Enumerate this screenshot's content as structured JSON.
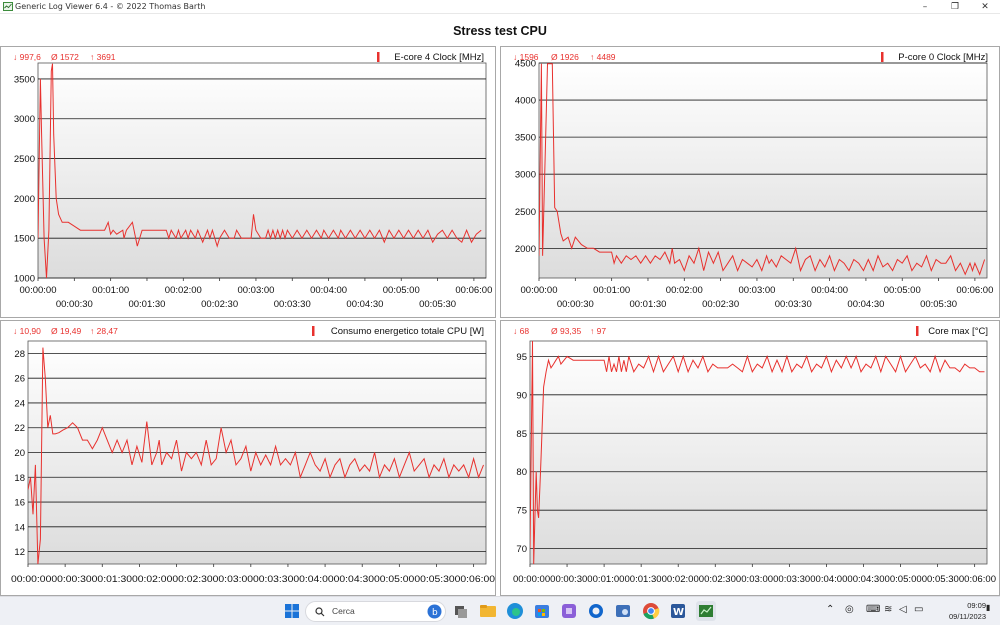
{
  "window": {
    "title": "Generic Log Viewer 6.4 - © 2022 Thomas Barth",
    "minimize": "–",
    "maximize": "❐",
    "close": "✕"
  },
  "headline": "Stress test CPU",
  "colors": {
    "line": "#e8312e",
    "grid": "#1a1a1a",
    "plotTop": "#ffffff",
    "plotBottom": "#dcdcdc"
  },
  "chart_data": [
    {
      "type": "line",
      "title": "E-core 4 Clock [MHz]",
      "stats": {
        "min": "997,6",
        "avg": "1572",
        "max": "3691"
      },
      "ylim": [
        1000,
        3700
      ],
      "yticks": [
        1000,
        1500,
        2000,
        2500,
        3000,
        3500
      ],
      "xlim": [
        0,
        370
      ],
      "xticks_top": [
        "00:00:00",
        "00:01:00",
        "00:02:00",
        "00:03:00",
        "00:04:00",
        "00:05:00",
        "00:06:00"
      ],
      "xticks_bottom": [
        "00:00:30",
        "00:01:30",
        "00:02:30",
        "00:03:30",
        "00:04:30",
        "00:05:30"
      ],
      "x": [
        0,
        2,
        3,
        5,
        7,
        9,
        11,
        12,
        13,
        15,
        17,
        20,
        25,
        30,
        35,
        40,
        48,
        55,
        58,
        60,
        62,
        65,
        70,
        71,
        73,
        78,
        82,
        86,
        90,
        95,
        100,
        103,
        106,
        108,
        110,
        114,
        116,
        118,
        122,
        124,
        126,
        130,
        132,
        136,
        140,
        142,
        144,
        148,
        150,
        154,
        158,
        162,
        164,
        168,
        172,
        176,
        178,
        180,
        184,
        188,
        190,
        192,
        194,
        196,
        198,
        200,
        202,
        204,
        206,
        210,
        214,
        218,
        222,
        226,
        230,
        234,
        236,
        240,
        244,
        248,
        250,
        254,
        258,
        262,
        266,
        270,
        274,
        278,
        282,
        286,
        290,
        294,
        298,
        302,
        306,
        310,
        314,
        318,
        322,
        326,
        330,
        334,
        338,
        342,
        346,
        350,
        354,
        358,
        362,
        366
      ],
      "y": [
        1500,
        3500,
        2800,
        1500,
        1000,
        1600,
        3600,
        3691,
        2800,
        2000,
        1800,
        1700,
        1700,
        1650,
        1600,
        1600,
        1600,
        1600,
        1700,
        1550,
        1600,
        1550,
        1600,
        1500,
        1600,
        1700,
        1400,
        1600,
        1600,
        1600,
        1600,
        1600,
        1600,
        1500,
        1600,
        1500,
        1600,
        1500,
        1600,
        1500,
        1600,
        1500,
        1600,
        1450,
        1600,
        1500,
        1600,
        1400,
        1500,
        1600,
        1500,
        1500,
        1600,
        1500,
        1500,
        1500,
        1800,
        1600,
        1500,
        1500,
        1600,
        1500,
        1600,
        1500,
        1600,
        1500,
        1600,
        1500,
        1600,
        1500,
        1600,
        1500,
        1600,
        1500,
        1600,
        1500,
        1600,
        1500,
        1600,
        1500,
        1600,
        1500,
        1600,
        1500,
        1600,
        1500,
        1600,
        1500,
        1600,
        1450,
        1600,
        1500,
        1600,
        1500,
        1600,
        1500,
        1600,
        1500,
        1600,
        1450,
        1550,
        1600,
        1500,
        1600,
        1500,
        1450,
        1600,
        1450,
        1550,
        1600
      ]
    },
    {
      "type": "line",
      "title": "P-core 0 Clock [MHz]",
      "stats": {
        "min": "1596",
        "avg": "1926",
        "max": "4489"
      },
      "ylim": [
        1600,
        4500
      ],
      "yticks": [
        2000,
        2500,
        3000,
        3500,
        4000,
        4500
      ],
      "xlim": [
        0,
        370
      ],
      "xticks_top": [
        "00:00:00",
        "00:01:00",
        "00:02:00",
        "00:03:00",
        "00:04:00",
        "00:05:00",
        "00:06:00"
      ],
      "xticks_bottom": [
        "00:00:30",
        "00:01:30",
        "00:02:30",
        "00:03:30",
        "00:04:30",
        "00:05:30"
      ],
      "x": [
        0,
        2,
        3,
        5,
        7,
        9,
        11,
        13,
        15,
        18,
        20,
        24,
        27,
        30,
        35,
        40,
        45,
        50,
        55,
        60,
        62,
        64,
        68,
        72,
        76,
        80,
        84,
        88,
        92,
        96,
        100,
        104,
        108,
        110,
        112,
        116,
        120,
        124,
        128,
        132,
        136,
        140,
        144,
        148,
        152,
        156,
        160,
        164,
        168,
        172,
        176,
        180,
        184,
        188,
        190,
        192,
        196,
        200,
        204,
        208,
        212,
        216,
        220,
        224,
        228,
        232,
        236,
        240,
        244,
        248,
        252,
        256,
        260,
        264,
        268,
        272,
        276,
        280,
        284,
        288,
        292,
        296,
        300,
        304,
        308,
        312,
        316,
        320,
        324,
        328,
        332,
        336,
        340,
        344,
        348,
        352,
        356,
        358,
        360,
        364,
        368
      ],
      "y": [
        1900,
        4489,
        1900,
        3200,
        4489,
        4489,
        4489,
        2550,
        2500,
        2200,
        2100,
        2150,
        2000,
        2150,
        2050,
        2000,
        2000,
        1950,
        1950,
        1950,
        1800,
        1900,
        1800,
        1900,
        1850,
        1900,
        1800,
        1900,
        1800,
        1900,
        1850,
        1950,
        1800,
        2000,
        1800,
        1850,
        1700,
        1900,
        1800,
        2000,
        1700,
        1950,
        1800,
        1950,
        1700,
        1800,
        1900,
        1700,
        1850,
        1800,
        1750,
        1850,
        1700,
        1900,
        1800,
        1850,
        1750,
        1900,
        1850,
        1800,
        2000,
        1700,
        1850,
        1900,
        1700,
        1850,
        1750,
        1900,
        1700,
        1850,
        1800,
        1700,
        1850,
        1800,
        1700,
        1850,
        1700,
        1900,
        1750,
        1800,
        1700,
        1850,
        1800,
        1900,
        1700,
        1800,
        1750,
        1900,
        1700,
        1850,
        1800,
        1800,
        1900,
        1700,
        1800,
        1650,
        1800,
        1700,
        1800,
        1650,
        1850
      ]
    },
    {
      "type": "line",
      "title": "Consumo energetico totale CPU [W]",
      "stats": {
        "min": "10,90",
        "avg": "19,49",
        "max": "28,47"
      },
      "ylim": [
        11,
        29
      ],
      "yticks": [
        12,
        14,
        16,
        18,
        20,
        22,
        24,
        26,
        28
      ],
      "xlim": [
        0,
        370
      ],
      "xticks_single": [
        "00:00:00",
        "00:00:30",
        "00:01:00",
        "00:01:30",
        "00:02:00",
        "00:02:30",
        "00:03:00",
        "00:03:30",
        "00:04:00",
        "00:04:30",
        "00:05:00",
        "00:05:30",
        "00:06:00"
      ],
      "xticks_joined": "00:00:0000:00:3000:01:3000:02:0000:02:3000:03:0000:03:3000:04:0000:04:3000:05:0000:05:3000:06:00",
      "x": [
        0,
        2,
        4,
        6,
        8,
        10,
        12,
        14,
        16,
        18,
        20,
        22,
        25,
        28,
        32,
        36,
        40,
        44,
        48,
        52,
        56,
        60,
        64,
        68,
        72,
        76,
        80,
        84,
        88,
        92,
        96,
        100,
        104,
        106,
        108,
        112,
        116,
        120,
        124,
        128,
        132,
        136,
        140,
        144,
        148,
        152,
        156,
        160,
        164,
        168,
        172,
        176,
        180,
        184,
        188,
        192,
        196,
        200,
        204,
        208,
        212,
        216,
        220,
        224,
        228,
        232,
        236,
        240,
        244,
        248,
        252,
        256,
        260,
        264,
        268,
        272,
        276,
        280,
        284,
        288,
        292,
        296,
        300,
        304,
        308,
        312,
        316,
        320,
        324,
        328,
        332,
        336,
        340,
        344,
        348,
        352,
        356,
        360,
        364,
        368
      ],
      "y": [
        17,
        18,
        15,
        19,
        11,
        13,
        28.47,
        26,
        22,
        23,
        21.5,
        21.5,
        21.6,
        21.8,
        22,
        22.4,
        22,
        21,
        21,
        20.3,
        21,
        22,
        21,
        20,
        21,
        20,
        21,
        19,
        20.5,
        19.2,
        22.5,
        19,
        20,
        21,
        19,
        20,
        19.5,
        21,
        18.5,
        20,
        19.5,
        20,
        19,
        21,
        19,
        19.5,
        22,
        20,
        21,
        19,
        19.5,
        20.5,
        18.5,
        20,
        19,
        19.8,
        19,
        20.5,
        19,
        19.5,
        19,
        20,
        18,
        19,
        20,
        19,
        18.5,
        19.5,
        18,
        19,
        19.5,
        18,
        19,
        19.5,
        18.5,
        19,
        18.5,
        20,
        18,
        19,
        18.5,
        19.5,
        18,
        19,
        20,
        18.5,
        19,
        19.5,
        18,
        19,
        18.5,
        19.5,
        18,
        19,
        18.5,
        19,
        18,
        19.5,
        18,
        19
      ]
    },
    {
      "type": "line",
      "title": "Core max [°C]",
      "stats": {
        "min": "68",
        "avg": "93,35",
        "max": "97"
      },
      "ylim": [
        68,
        97
      ],
      "yticks": [
        70,
        75,
        80,
        85,
        90,
        95
      ],
      "xlim": [
        0,
        370
      ],
      "xticks_single": [
        "00:00:00",
        "00:00:30",
        "00:01:00",
        "00:01:30",
        "00:02:00",
        "00:02:30",
        "00:03:00",
        "00:03:30",
        "00:04:00",
        "00:04:30",
        "00:05:00",
        "00:05:30",
        "00:06:00"
      ],
      "xticks_joined": "00:00:0000:00:3000:01:0000:01:3000:02:0000:02:3000:03:0000:03:3000:04:0000:04:3000:05:0000:05:3000:06:00",
      "x": [
        0,
        2,
        3,
        4,
        5,
        6,
        7,
        8,
        9,
        11,
        13,
        15,
        17,
        19,
        21,
        23,
        25,
        30,
        35,
        40,
        45,
        50,
        55,
        60,
        62,
        64,
        66,
        68,
        70,
        72,
        74,
        76,
        78,
        80,
        84,
        88,
        92,
        96,
        100,
        104,
        108,
        112,
        116,
        120,
        124,
        128,
        132,
        136,
        140,
        144,
        148,
        152,
        156,
        160,
        164,
        168,
        172,
        176,
        180,
        184,
        188,
        192,
        196,
        200,
        204,
        208,
        212,
        216,
        220,
        224,
        228,
        232,
        236,
        240,
        244,
        248,
        252,
        256,
        260,
        264,
        268,
        272,
        276,
        280,
        284,
        288,
        292,
        296,
        300,
        304,
        308,
        312,
        316,
        320,
        324,
        328,
        332,
        336,
        340,
        344,
        348,
        352,
        356,
        360,
        364,
        368
      ],
      "y": [
        70,
        97,
        68,
        74,
        80,
        75,
        74,
        78,
        82,
        91,
        93,
        94.5,
        93.5,
        94,
        94.5,
        95,
        94,
        95,
        94.5,
        94.5,
        94.5,
        94.5,
        94.5,
        94.5,
        93,
        95,
        93,
        94,
        93,
        95,
        93,
        94.5,
        93,
        95,
        93,
        94,
        93.5,
        95,
        93,
        95,
        93,
        94,
        95,
        93,
        95,
        93,
        94.5,
        93.5,
        95,
        93,
        94,
        93.5,
        93.5,
        93.5,
        94,
        93.5,
        93,
        95,
        93,
        94,
        93.5,
        95,
        93,
        94.5,
        93,
        95,
        93,
        94,
        93.5,
        95,
        93,
        94,
        93.5,
        95,
        93,
        94.5,
        93.5,
        95,
        93.5,
        95,
        93,
        94,
        93.5,
        95,
        93,
        95,
        94,
        93,
        95,
        93,
        94,
        95,
        93.5,
        94,
        93,
        95,
        93,
        94.5,
        93.5,
        93.5,
        93,
        94,
        93.5,
        93.5,
        93,
        93
      ]
    }
  ],
  "taskbar": {
    "search_placeholder": "Cerca",
    "time": "09:09",
    "date": "09/11/2023"
  }
}
